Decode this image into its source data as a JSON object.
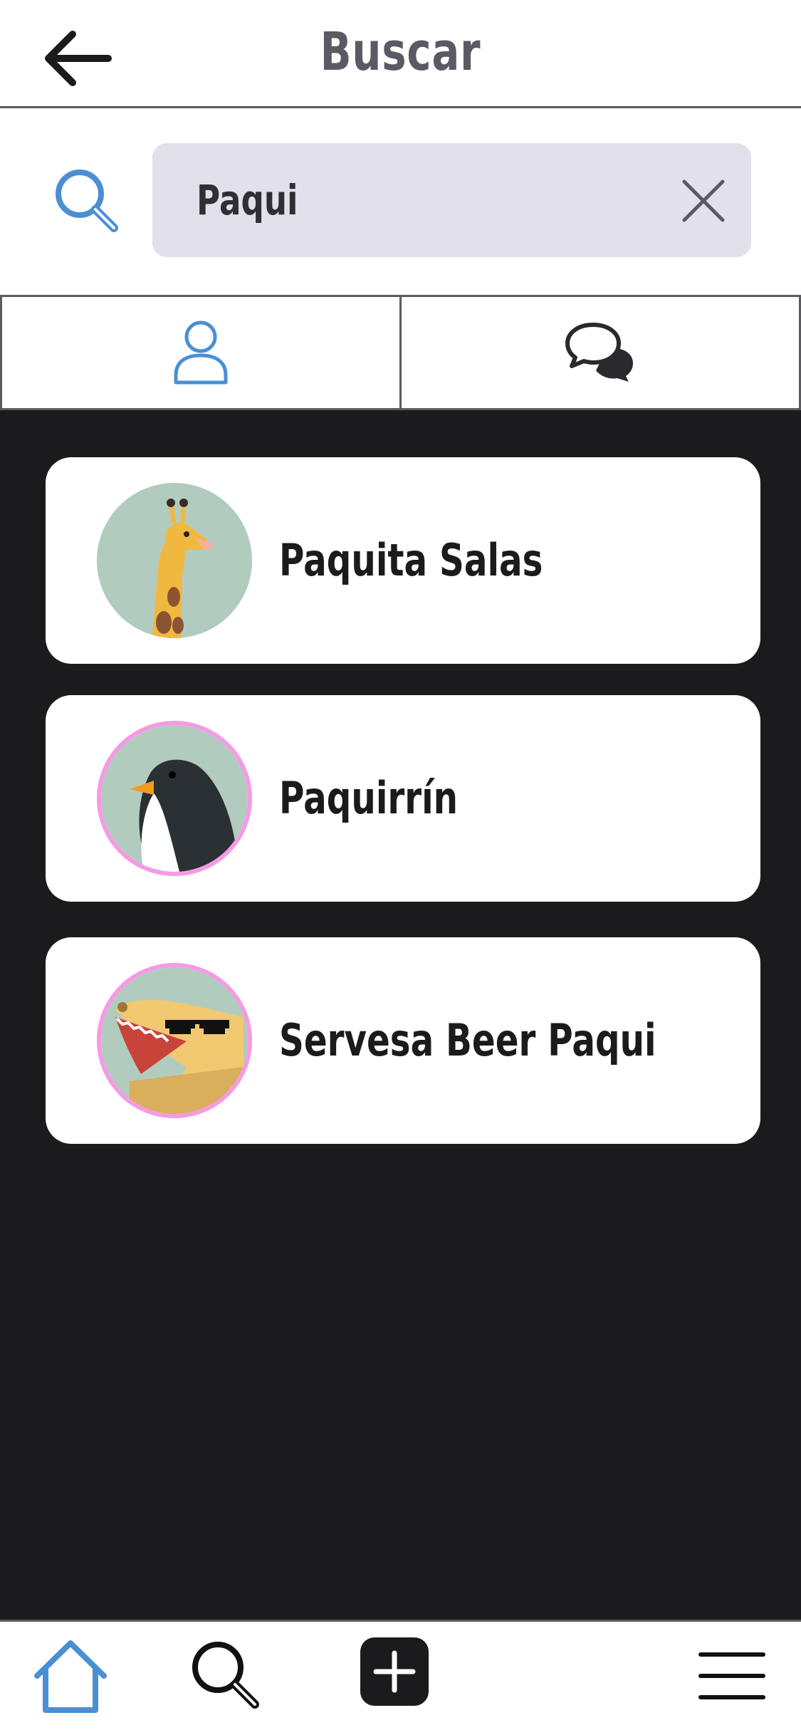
{
  "header": {
    "title": "Buscar",
    "back_icon": "arrow-left-icon"
  },
  "search": {
    "value": "Paqui",
    "icon": "search-icon",
    "clear_icon": "close-icon"
  },
  "tabs": [
    {
      "name": "people",
      "icon": "user-icon",
      "active": true
    },
    {
      "name": "chats",
      "icon": "chat-bubbles-icon",
      "active": false
    }
  ],
  "results": [
    {
      "name": "Paquita Salas",
      "avatar": "giraffe-avatar",
      "ring": false
    },
    {
      "name": "Paquirrín",
      "avatar": "penguin-avatar",
      "ring": true
    },
    {
      "name": "Servesa Beer Paqui",
      "avatar": "crocodile-avatar",
      "ring": true
    }
  ],
  "bottom_nav": [
    {
      "name": "home",
      "icon": "home-icon",
      "active": true
    },
    {
      "name": "search",
      "icon": "search-icon"
    },
    {
      "name": "add",
      "icon": "plus-icon"
    },
    {
      "name": "menu",
      "icon": "hamburger-icon"
    }
  ],
  "colors": {
    "accent": "#4a8fd4",
    "background": "#1b1b1d",
    "ring": "#f59ae5",
    "search_bg": "#e2e0ea",
    "avatar_bg": "#b2cbbf"
  }
}
